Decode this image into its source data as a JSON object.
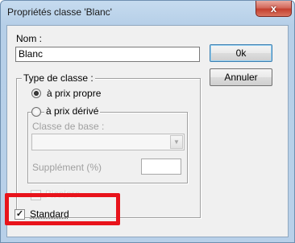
{
  "window": {
    "title": "Propriétés classe 'Blanc'",
    "close_glyph": "x"
  },
  "form": {
    "nom_label": "Nom :",
    "nom_value": "Blanc",
    "ok_label": "0k",
    "cancel_label": "Annuler",
    "type_group_label": "Type de classe :",
    "prix_propre_label": "à prix propre",
    "prix_propre_selected": true,
    "prix_derive_label": "à prix dérivé",
    "prix_derive_selected": false,
    "classe_base_label": "Classe de base :",
    "classe_base_value": "",
    "supplement_label": "Supplément (%)",
    "supplement_value": "",
    "bicolore_label": "Bicolore",
    "bicolore_checked": false,
    "standard_label": "Standard",
    "standard_checked": true,
    "standard_check_glyph": "✓"
  },
  "colors": {
    "highlight": "#e8131b",
    "title_bar": "#b9d1ea",
    "close_button": "#c84a3a"
  }
}
